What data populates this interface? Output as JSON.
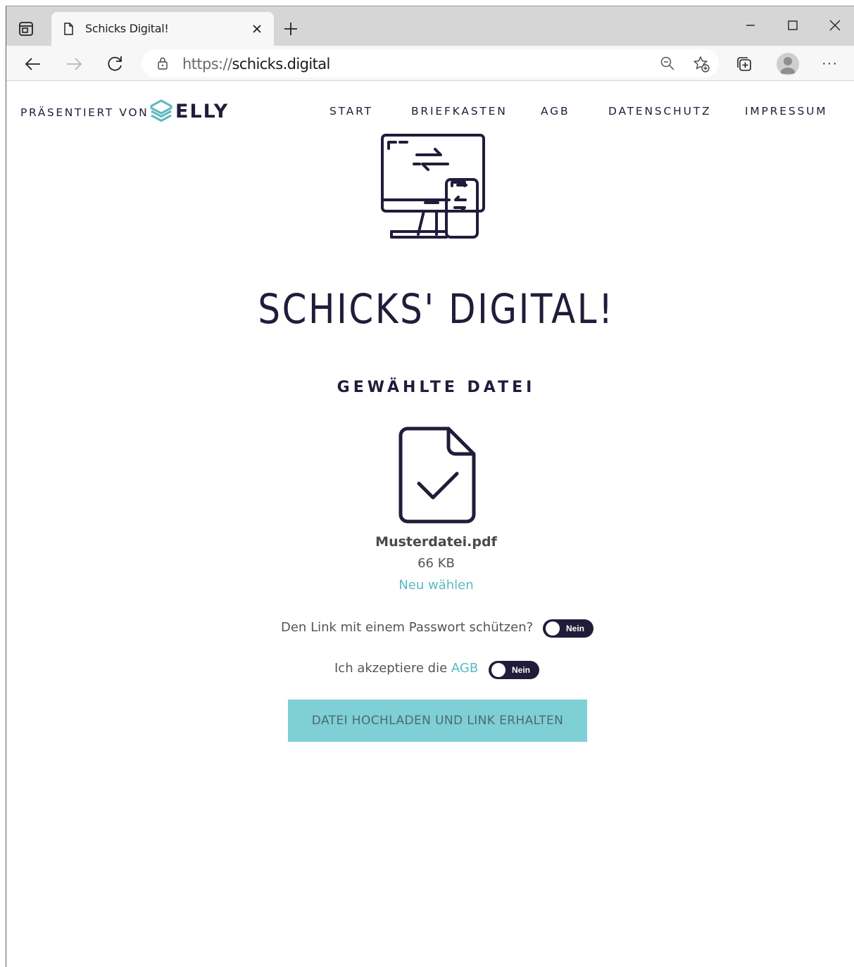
{
  "browser": {
    "tab_title": "Schicks Digital!",
    "url_scheme": "https://",
    "url_host": "schicks.digital",
    "more_label": "···"
  },
  "header": {
    "presented_by": "PRÄSENTIERT VON",
    "brand": "ELLY",
    "nav": [
      "START",
      "BRIEFKASTEN",
      "AGB",
      "DATENSCHUTZ",
      "IMPRESSUM"
    ]
  },
  "hero": {
    "title": "SCHICKS' DIGITAL!"
  },
  "file": {
    "section_title": "GEWÄHLTE DATEI",
    "name": "Musterdatei.pdf",
    "size": "66 KB",
    "reselect": "Neu wählen"
  },
  "options": {
    "password_label": "Den Link mit einem Passwort schützen?",
    "password_toggle": "Nein",
    "terms_prefix": "Ich akzeptiere die ",
    "terms_link": "AGB",
    "terms_toggle": "Nein"
  },
  "upload_button": "DATEI HOCHLADEN UND LINK ERHALTEN",
  "colors": {
    "accent": "#5cb9c2",
    "button": "#7ecfd6",
    "navy": "#1f1d3a"
  }
}
